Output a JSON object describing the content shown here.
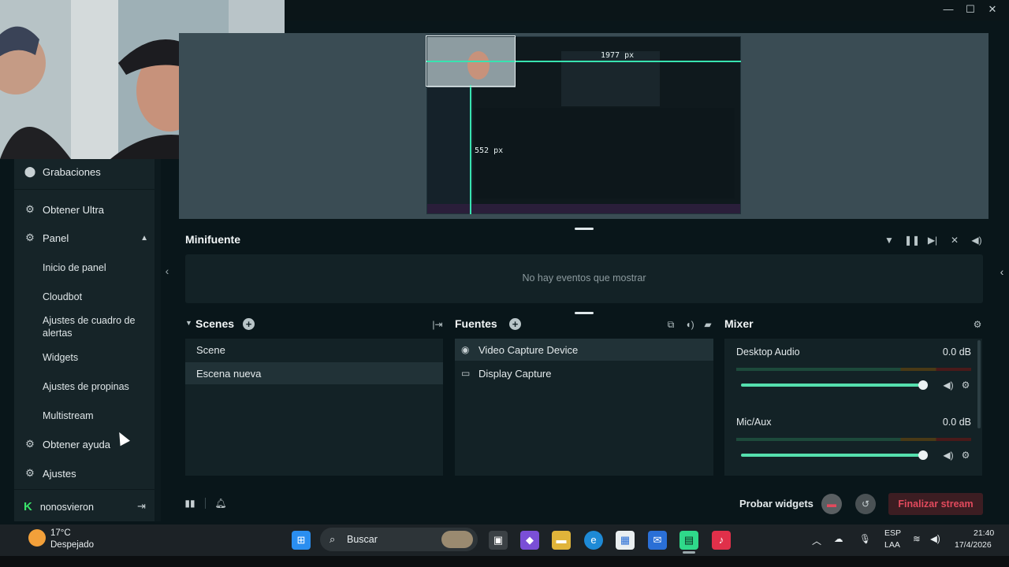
{
  "sidebar": {
    "items": [
      {
        "label": "Grabaciones",
        "icon": "record-circle-icon"
      },
      {
        "label": "Obtener Ultra",
        "icon": "ultra-gear-icon"
      },
      {
        "label": "Panel",
        "icon": "panel-gear-icon"
      },
      {
        "label": "Obtener ayuda",
        "icon": "help-gear-icon"
      },
      {
        "label": "Ajustes",
        "icon": "settings-gear-icon"
      }
    ],
    "panel_subitems": [
      "Inicio de panel",
      "Cloudbot",
      "Ajustes de cuadro de alertas",
      "Widgets",
      "Ajustes de propinas",
      "Multistream"
    ],
    "user": {
      "name": "nonosvieron",
      "logout_icon": "logout-icon"
    }
  },
  "preview": {
    "width_label": "1977 px",
    "height_label": "552 px"
  },
  "minifeed": {
    "title": "Minifuente",
    "empty_text": "No hay eventos que mostrar"
  },
  "scenes": {
    "title": "Scenes",
    "items": [
      "Scene",
      "Escena nueva"
    ],
    "selected_index": 1
  },
  "sources": {
    "title": "Fuentes",
    "items": [
      {
        "label": "Video Capture Device",
        "icon": "camera-icon"
      },
      {
        "label": "Display Capture",
        "icon": "monitor-icon"
      }
    ],
    "selected_index": 0
  },
  "mixer": {
    "title": "Mixer",
    "channels": [
      {
        "name": "Desktop Audio",
        "db": "0.0 dB",
        "volume": 1.0
      },
      {
        "name": "Mic/Aux",
        "db": "0.0 dB",
        "volume": 1.0
      }
    ]
  },
  "footer": {
    "test_widgets": "Probar widgets",
    "end_stream": "Finalizar stream"
  },
  "taskbar": {
    "weather_temp": "17°C",
    "weather_desc": "Despejado",
    "search_placeholder": "Buscar",
    "lang_top": "ESP",
    "lang_bottom": "LAA",
    "time": "21:40",
    "date": "17/4/2026"
  },
  "colors": {
    "accent": "#38e3b0",
    "slider": "#55e0ae",
    "end_stream": "#e24a5d"
  }
}
